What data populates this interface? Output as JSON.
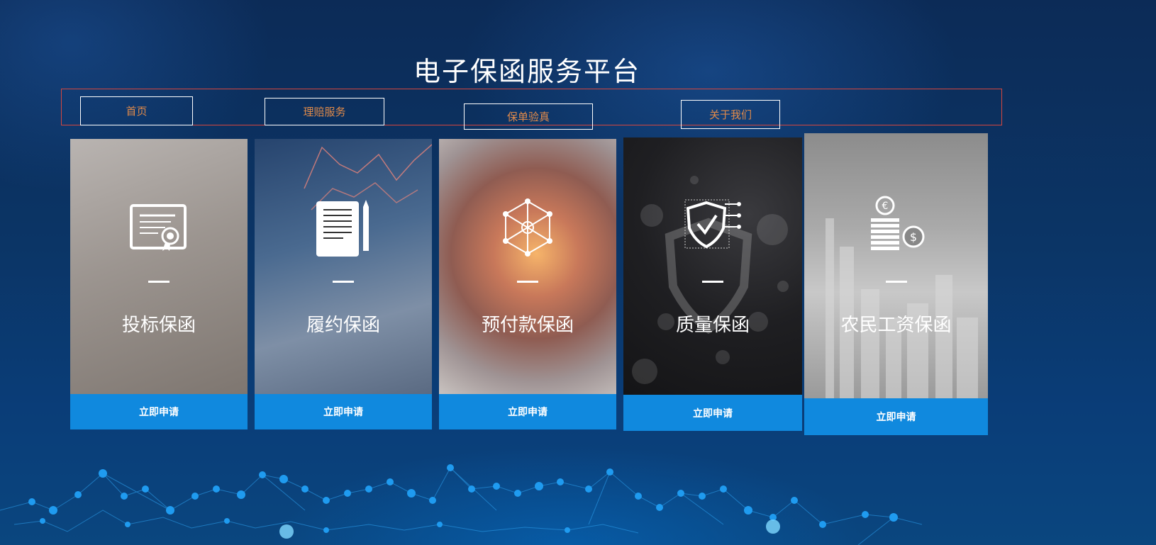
{
  "header": {
    "title": "电子保函服务平台"
  },
  "nav": {
    "items": [
      {
        "label": "首页"
      },
      {
        "label": "理赔服务"
      },
      {
        "label": "保单验真"
      },
      {
        "label": "关于我们"
      }
    ]
  },
  "cards": [
    {
      "name": "投标保函",
      "action": "立即申请",
      "icon": "certificate-icon"
    },
    {
      "name": "履约保函",
      "action": "立即申请",
      "icon": "contract-pen-icon"
    },
    {
      "name": "预付款保函",
      "action": "立即申请",
      "icon": "network-node-icon"
    },
    {
      "name": "质量保函",
      "action": "立即申请",
      "icon": "shield-check-icon"
    },
    {
      "name": "农民工资保函",
      "action": "立即申请",
      "icon": "coins-icon"
    }
  ]
}
